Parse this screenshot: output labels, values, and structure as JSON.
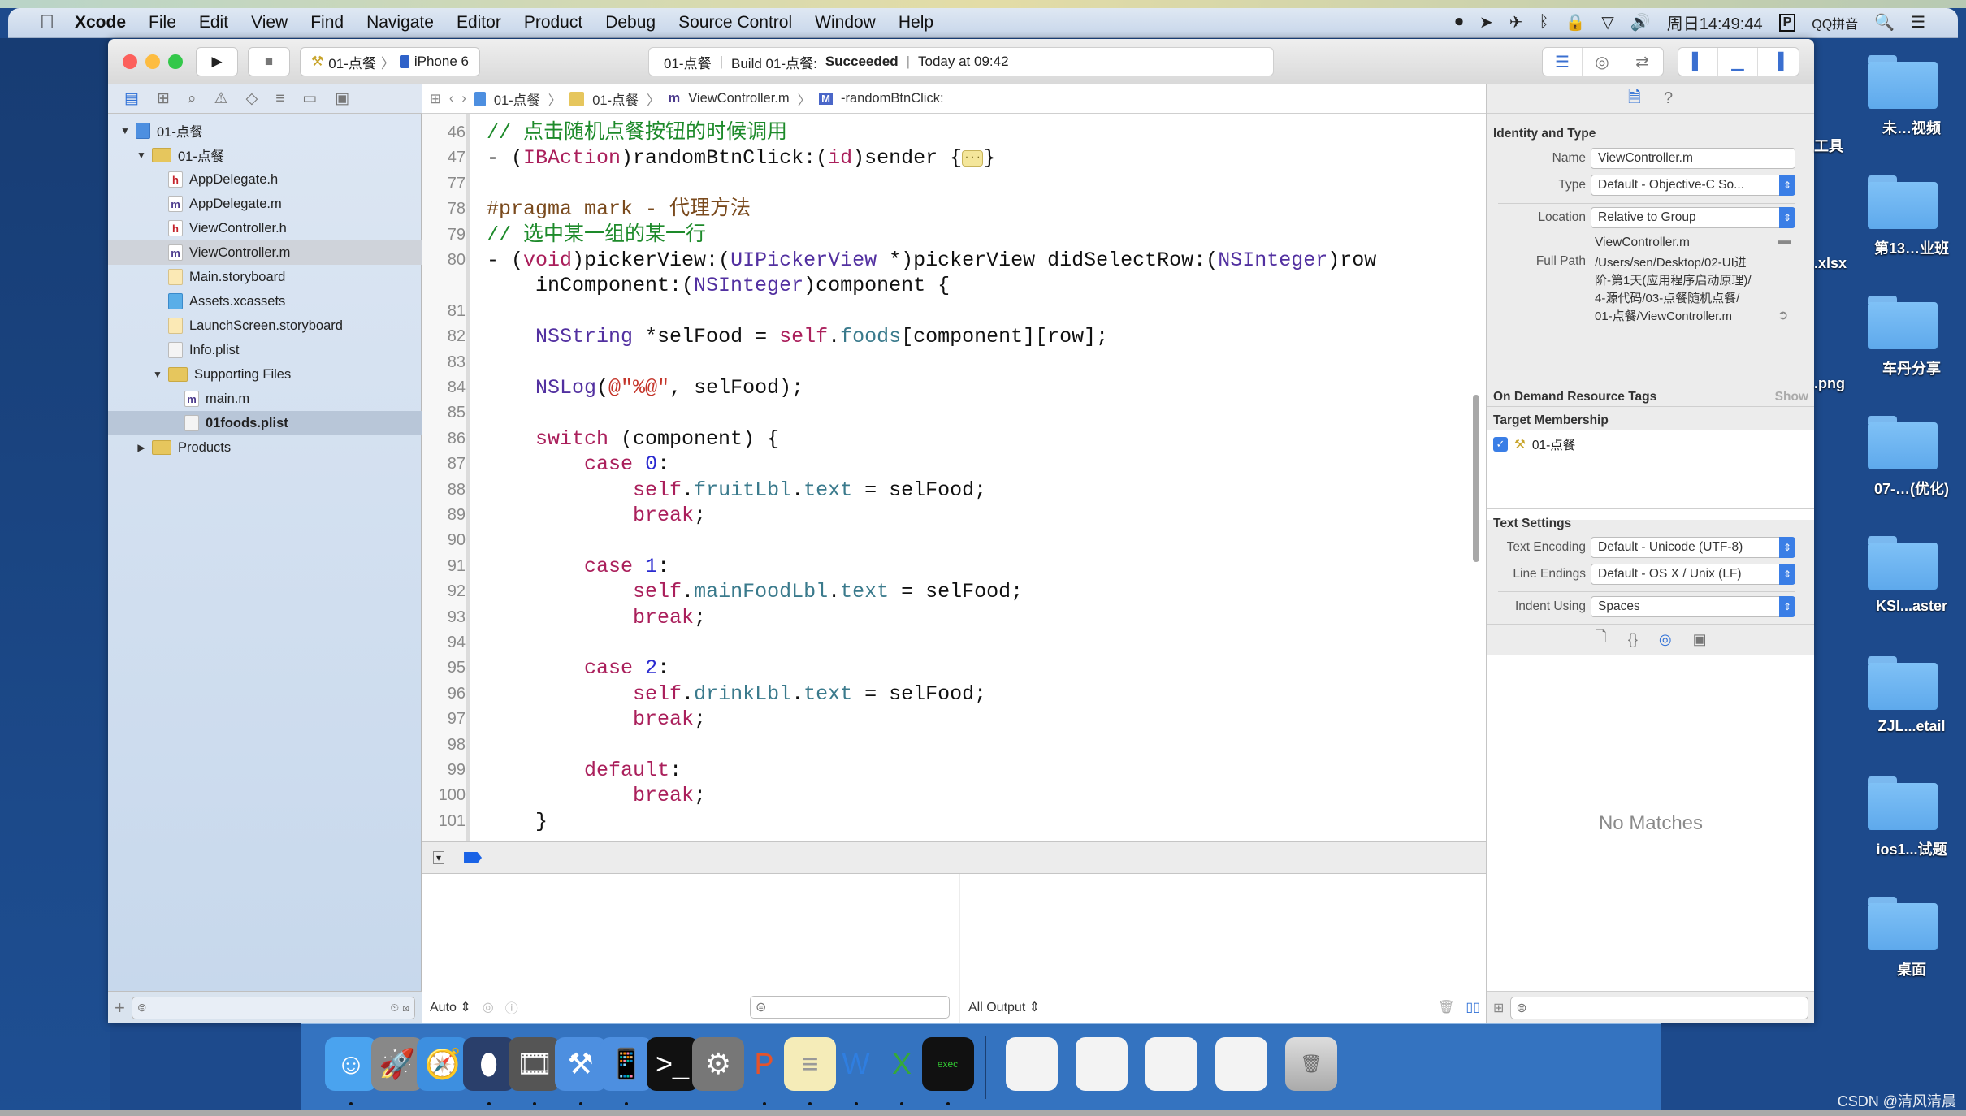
{
  "menubar": {
    "apple": "",
    "app_name": "Xcode",
    "items": [
      "File",
      "Edit",
      "View",
      "Find",
      "Navigate",
      "Editor",
      "Product",
      "Debug",
      "Source Control",
      "Window",
      "Help"
    ],
    "clock": "周日14:49:44",
    "input_method": "QQ拼音"
  },
  "toolbar": {
    "scheme": "01-点餐",
    "device": "iPhone 6",
    "status_project": "01-点餐",
    "status_build": "Build 01-点餐:",
    "status_result": "Succeeded",
    "status_time": "Today at 09:42"
  },
  "jumpbar": {
    "crumbs": [
      "01-点餐",
      "01-点餐",
      "ViewController.m",
      "-randomBtnClick:"
    ]
  },
  "navigator": {
    "items": [
      {
        "label": "01-点餐",
        "kind": "proj",
        "level": 0,
        "disclosure": "open"
      },
      {
        "label": "01-点餐",
        "kind": "folder",
        "level": 1,
        "disclosure": "open"
      },
      {
        "label": "AppDelegate.h",
        "kind": "h",
        "level": 2
      },
      {
        "label": "AppDelegate.m",
        "kind": "m",
        "level": 2
      },
      {
        "label": "ViewController.h",
        "kind": "h",
        "level": 2
      },
      {
        "label": "ViewController.m",
        "kind": "m",
        "level": 2,
        "state": "selected-inactive"
      },
      {
        "label": "Main.storyboard",
        "kind": "sb",
        "level": 2
      },
      {
        "label": "Assets.xcassets",
        "kind": "assets",
        "level": 2
      },
      {
        "label": "LaunchScreen.storyboard",
        "kind": "sb",
        "level": 2
      },
      {
        "label": "Info.plist",
        "kind": "plist",
        "level": 2
      },
      {
        "label": "Supporting Files",
        "kind": "folder",
        "level": 2,
        "disclosure": "open"
      },
      {
        "label": "main.m",
        "kind": "m",
        "level": 3
      },
      {
        "label": "01foods.plist",
        "kind": "plist",
        "level": 3,
        "state": "selected"
      },
      {
        "label": "Products",
        "kind": "folder",
        "level": 1,
        "disclosure": "closed"
      }
    ]
  },
  "editor": {
    "lines": [
      {
        "n": "46",
        "html": "<span class=\"c\">// 点击随机点餐按钮的时候调用</span>"
      },
      {
        "n": "47",
        "html": "- (<span class=\"k\">IBAction</span>)randomBtnClick:(<span class=\"k\">id</span>)sender {<span class=\"fold\">···</span>}"
      },
      {
        "n": "77",
        "html": ""
      },
      {
        "n": "78",
        "html": "<span class=\"p\">#pragma mark - 代理方法</span>"
      },
      {
        "n": "79",
        "html": "<span class=\"c\">// 选中某一组的某一行</span>"
      },
      {
        "n": "80",
        "html": "- (<span class=\"k\">void</span>)pickerView:(<span class=\"t\">UIPickerView</span> *)pickerView didSelectRow:(<span class=\"t\">NSInteger</span>)row"
      },
      {
        "n": "",
        "html": "    inComponent:(<span class=\"t\">NSInteger</span>)component {"
      },
      {
        "n": "81",
        "html": ""
      },
      {
        "n": "82",
        "html": "    <span class=\"t\">NSString</span> *selFood = <span class=\"k\">self</span>.<span class=\"pr\">foods</span>[component][row];"
      },
      {
        "n": "83",
        "html": ""
      },
      {
        "n": "84",
        "html": "    <span class=\"t\">NSLog</span>(<span class=\"s\">@\"%@\"</span>, selFood);"
      },
      {
        "n": "85",
        "html": ""
      },
      {
        "n": "86",
        "html": "    <span class=\"k\">switch</span> (component) {"
      },
      {
        "n": "87",
        "html": "        <span class=\"k\">case</span> <span class=\"n\">0</span>:"
      },
      {
        "n": "88",
        "html": "            <span class=\"k\">self</span>.<span class=\"pr\">fruitLbl</span>.<span class=\"pr\">text</span> = selFood;"
      },
      {
        "n": "89",
        "html": "            <span class=\"k\">break</span>;"
      },
      {
        "n": "90",
        "html": ""
      },
      {
        "n": "91",
        "html": "        <span class=\"k\">case</span> <span class=\"n\">1</span>:"
      },
      {
        "n": "92",
        "html": "            <span class=\"k\">self</span>.<span class=\"pr\">mainFoodLbl</span>.<span class=\"pr\">text</span> = selFood;"
      },
      {
        "n": "93",
        "html": "            <span class=\"k\">break</span>;"
      },
      {
        "n": "94",
        "html": ""
      },
      {
        "n": "95",
        "html": "        <span class=\"k\">case</span> <span class=\"n\">2</span>:"
      },
      {
        "n": "96",
        "html": "            <span class=\"k\">self</span>.<span class=\"pr\">drinkLbl</span>.<span class=\"pr\">text</span> = selFood;"
      },
      {
        "n": "97",
        "html": "            <span class=\"k\">break</span>;"
      },
      {
        "n": "98",
        "html": ""
      },
      {
        "n": "99",
        "html": "        <span class=\"k\">default</span>:"
      },
      {
        "n": "100",
        "html": "            <span class=\"k\">break</span>;"
      },
      {
        "n": "101",
        "html": "    }"
      }
    ]
  },
  "debug": {
    "auto_label": "Auto ⇕",
    "all_output_label": "All Output ⇕"
  },
  "inspector": {
    "identity_title": "Identity and Type",
    "name_label": "Name",
    "name_value": "ViewController.m",
    "type_label": "Type",
    "type_value": "Default - Objective-C So...",
    "location_label": "Location",
    "location_value": "Relative to Group",
    "location_file": "ViewController.m",
    "fullpath_label": "Full Path",
    "fullpath_lines": [
      "/Users/sen/Desktop/02-UI进",
      "阶-第1天(应用程序启动原理)/",
      "4-源代码/03-点餐随机点餐/",
      "01-点餐/ViewController.m"
    ],
    "odr_title": "On Demand Resource Tags",
    "odr_show": "Show",
    "target_title": "Target Membership",
    "target_name": "01-点餐",
    "target_checked": true,
    "text_settings_title": "Text Settings",
    "encoding_label": "Text Encoding",
    "encoding_value": "Default - Unicode (UTF-8)",
    "line_endings_label": "Line Endings",
    "line_endings_value": "Default - OS X / Unix (LF)",
    "indent_label": "Indent Using",
    "indent_value": "Spaces",
    "no_matches": "No Matches"
  },
  "desktop": {
    "folders": [
      "未…视频",
      "第13…业班",
      "车丹分享",
      "07-…(优化)",
      "KSI...aster",
      "ZJL...etail",
      "ios1...试题",
      "桌面"
    ],
    "partial_labels": [
      "工具",
      ".xlsx",
      ".png"
    ]
  },
  "dock": {
    "apps": [
      "finder",
      "launchpad",
      "safari",
      "mouse",
      "photo-booth",
      "xcode",
      "simulator",
      "terminal",
      "system-preferences",
      "powerpoint-like",
      "notes",
      "word",
      "excel",
      "exec-terminal"
    ],
    "docs": [
      "screenshot-1",
      "screenshot-2",
      "document",
      "preview-image",
      "trash"
    ]
  },
  "watermark": "CSDN @清风清晨"
}
